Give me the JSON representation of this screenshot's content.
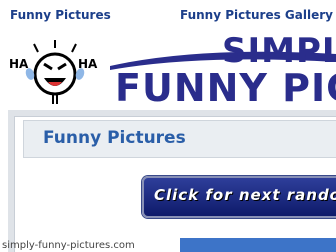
{
  "nav": {
    "links": [
      {
        "label": "Funny Pictures"
      },
      {
        "label": "Funny Pictures Gallery"
      }
    ]
  },
  "banner": {
    "logo_text_left": "HA",
    "logo_text_right": "HA",
    "title_line1": "SIMPLY",
    "title_line2": "FUNNY PICTURES"
  },
  "main": {
    "title": "Funny Pictures",
    "next_button_label": "Click for next random"
  },
  "watermark": "simply-funny-pictures.com",
  "colors": {
    "nav_link": "#1c3f8a",
    "banner_title": "#2a2d8c",
    "page_title": "#2a5ea8",
    "button_bg": "#1a2a7e",
    "strip": "#3d74c8"
  }
}
